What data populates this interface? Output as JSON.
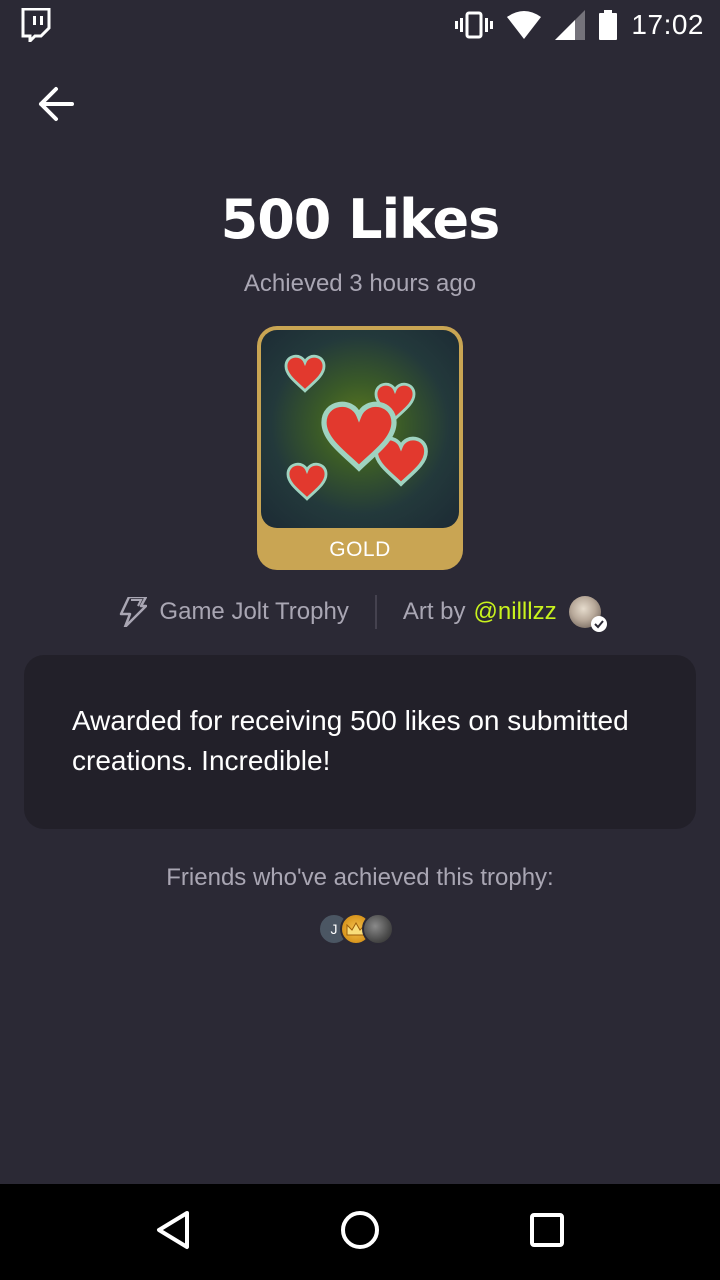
{
  "status_bar": {
    "time": "17:02",
    "icons": [
      "twitch-icon",
      "vibrate-icon",
      "wifi-icon",
      "signal-icon",
      "battery-icon"
    ]
  },
  "header": {
    "title": "500 Likes",
    "achieved": "Achieved 3 hours ago"
  },
  "trophy": {
    "tier": "GOLD",
    "tier_color": "#c9a553"
  },
  "meta": {
    "source": "Game Jolt Trophy",
    "art_by_label": "Art by",
    "artist": "@nilllzz",
    "artist_color": "#c9f31d"
  },
  "description": "Awarded for receiving 500 likes on submitted creations. Incredible!",
  "friends": {
    "title": "Friends who've achieved this trophy:",
    "avatars": [
      {
        "initial": "J"
      },
      {
        "initial": ""
      },
      {
        "initial": ""
      }
    ]
  },
  "colors": {
    "background": "#2b2935",
    "card": "#222029",
    "muted_text": "#a9a6b3"
  }
}
